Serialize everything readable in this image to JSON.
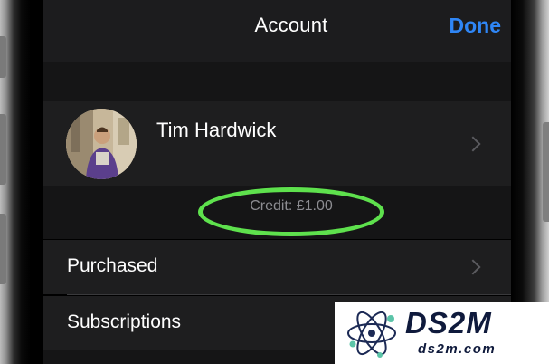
{
  "nav": {
    "title": "Account",
    "done_label": "Done"
  },
  "profile": {
    "name": "Tim Hardwick",
    "avatar_icon": "user-photo"
  },
  "credit": {
    "text": "Credit: £1.00",
    "highlight_color": "#5ee14d"
  },
  "list": {
    "items": [
      {
        "label": "Purchased"
      },
      {
        "label": "Subscriptions"
      }
    ]
  },
  "watermark": {
    "main": "DS2M",
    "sub": "ds2m.com"
  },
  "colors": {
    "accent": "#2f86f6",
    "row_bg": "#1e1e1f",
    "group_bg": "#151516",
    "text_primary": "#ffffff",
    "text_secondary": "#8d8d92"
  }
}
